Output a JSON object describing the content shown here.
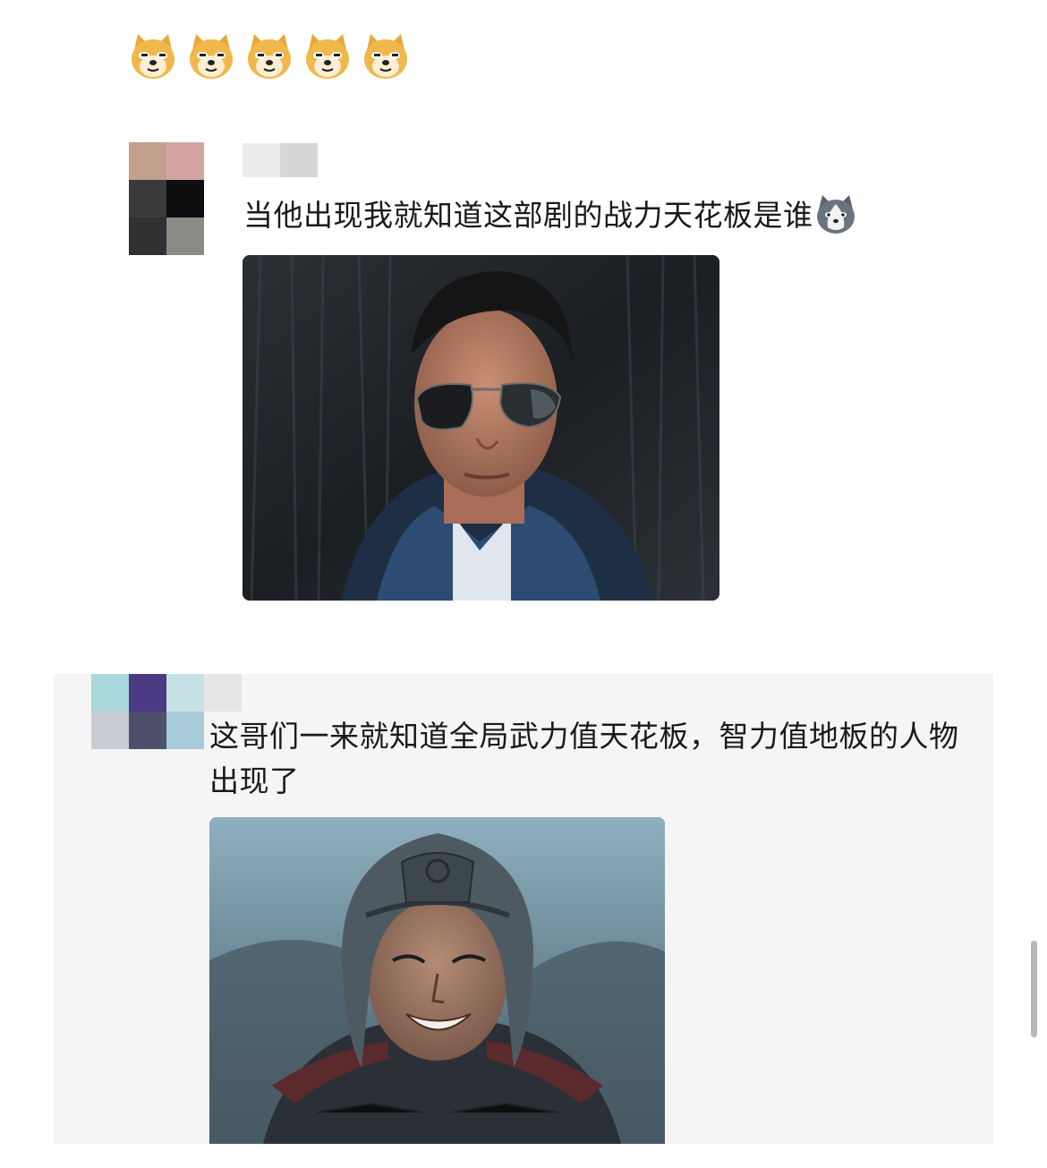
{
  "post": {
    "reaction_emojis": [
      "doge-emoji",
      "doge-emoji",
      "doge-emoji",
      "doge-emoji",
      "doge-emoji"
    ]
  },
  "comments": [
    {
      "avatar": "pixelated-avatar",
      "username": "",
      "text": "当他出现我就知道这部剧的战力天花板是谁",
      "emoji": "husky-emoji",
      "image": "man-in-aviator-sunglasses-photo",
      "colors": {
        "avatar": [
          "#c3a08c",
          "#d4a4a2",
          "#3a3a3c",
          "#0e0e10",
          "#313133",
          "#8a8b84"
        ],
        "name": [
          "#ececec",
          "#d6d6d6"
        ]
      }
    },
    {
      "avatar": "pixelated-avatar",
      "username": "",
      "text": "这哥们一来就知道全局武力值天花板，智力值地板的人物出现了",
      "image": "smiling-soldier-in-helmet-photo",
      "colors": {
        "avatar": [
          "#a9d8dc",
          "#4c3984",
          "#c6e2e6",
          "#c9ccd2",
          "#4e4f6b",
          "#a8cbd9"
        ],
        "name": [
          "#e6e6e6"
        ]
      }
    }
  ],
  "ui": {
    "scrollbar": "vertical-scrollbar"
  }
}
